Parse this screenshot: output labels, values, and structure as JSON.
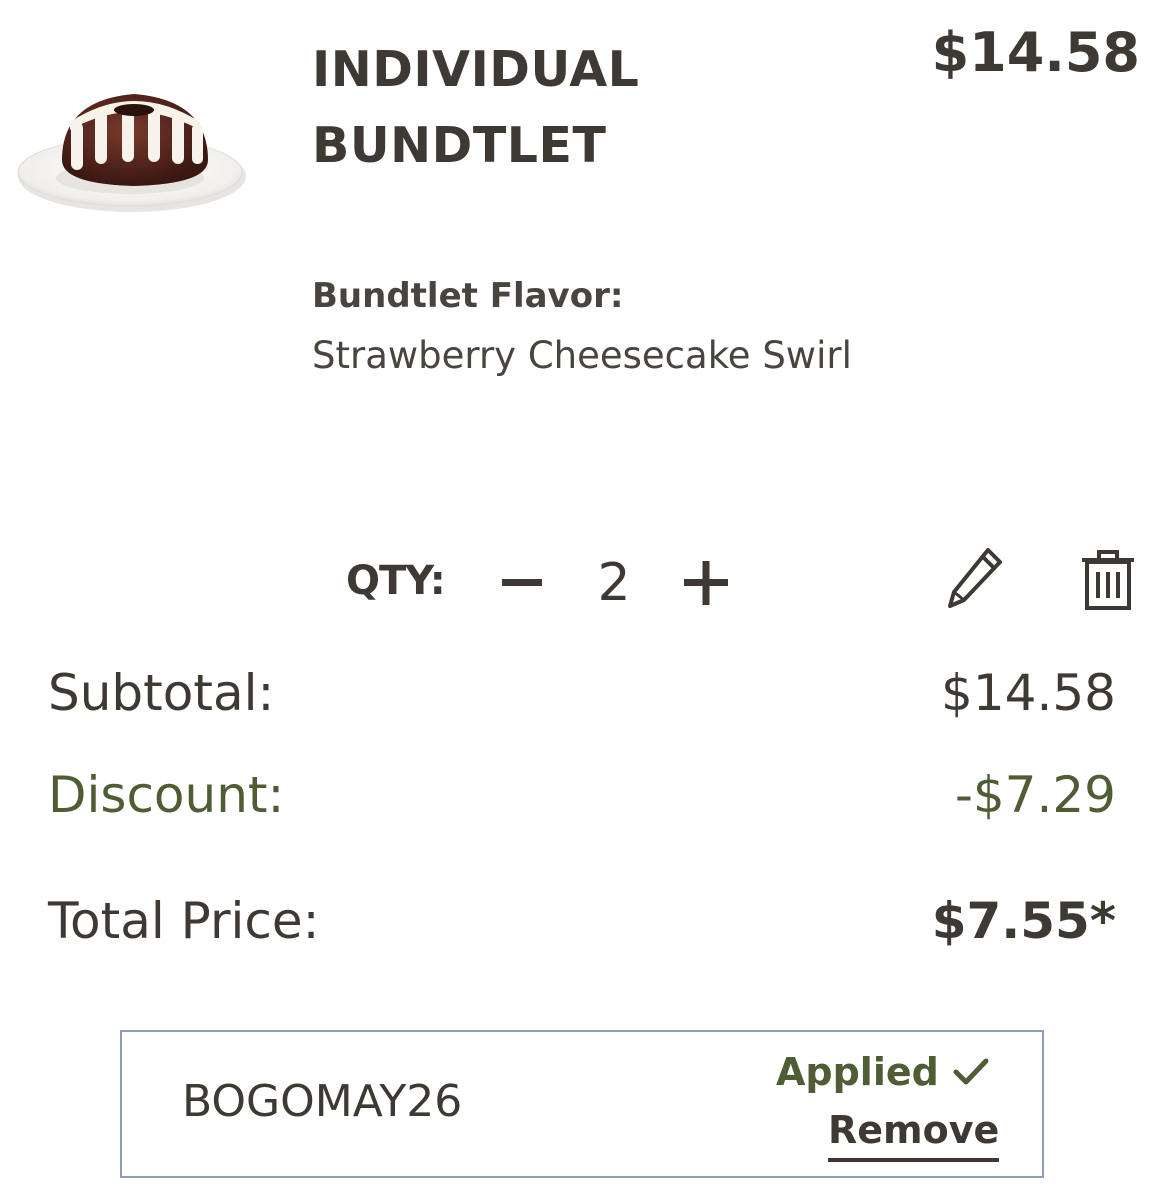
{
  "product": {
    "name_line1": "INDIVIDUAL",
    "name_line2": "BUNDTLET",
    "price": "$14.58",
    "image_icon": "bundtlet-cake-image",
    "flavor_label": "Bundtlet Flavor:",
    "flavor_value": "Strawberry Cheesecake Swirl"
  },
  "quantity": {
    "label": "QTY:",
    "value": "2",
    "minus_icon": "minus-icon",
    "plus_icon": "plus-icon"
  },
  "actions": {
    "edit_icon": "pencil-icon",
    "delete_icon": "trash-icon"
  },
  "summary": {
    "subtotal_label": "Subtotal:",
    "subtotal_value": "$14.58",
    "discount_label": "Discount:",
    "discount_value": "-$7.29",
    "total_label": "Total Price:",
    "total_value": "$7.55*"
  },
  "promo": {
    "code": "BOGOMAY26",
    "status": "Applied",
    "status_icon": "checkmark-icon",
    "remove_label": "Remove"
  },
  "colors": {
    "text": "#3f3933",
    "discount_green": "#4e5d34",
    "promo_border": "#8c9cbd"
  }
}
